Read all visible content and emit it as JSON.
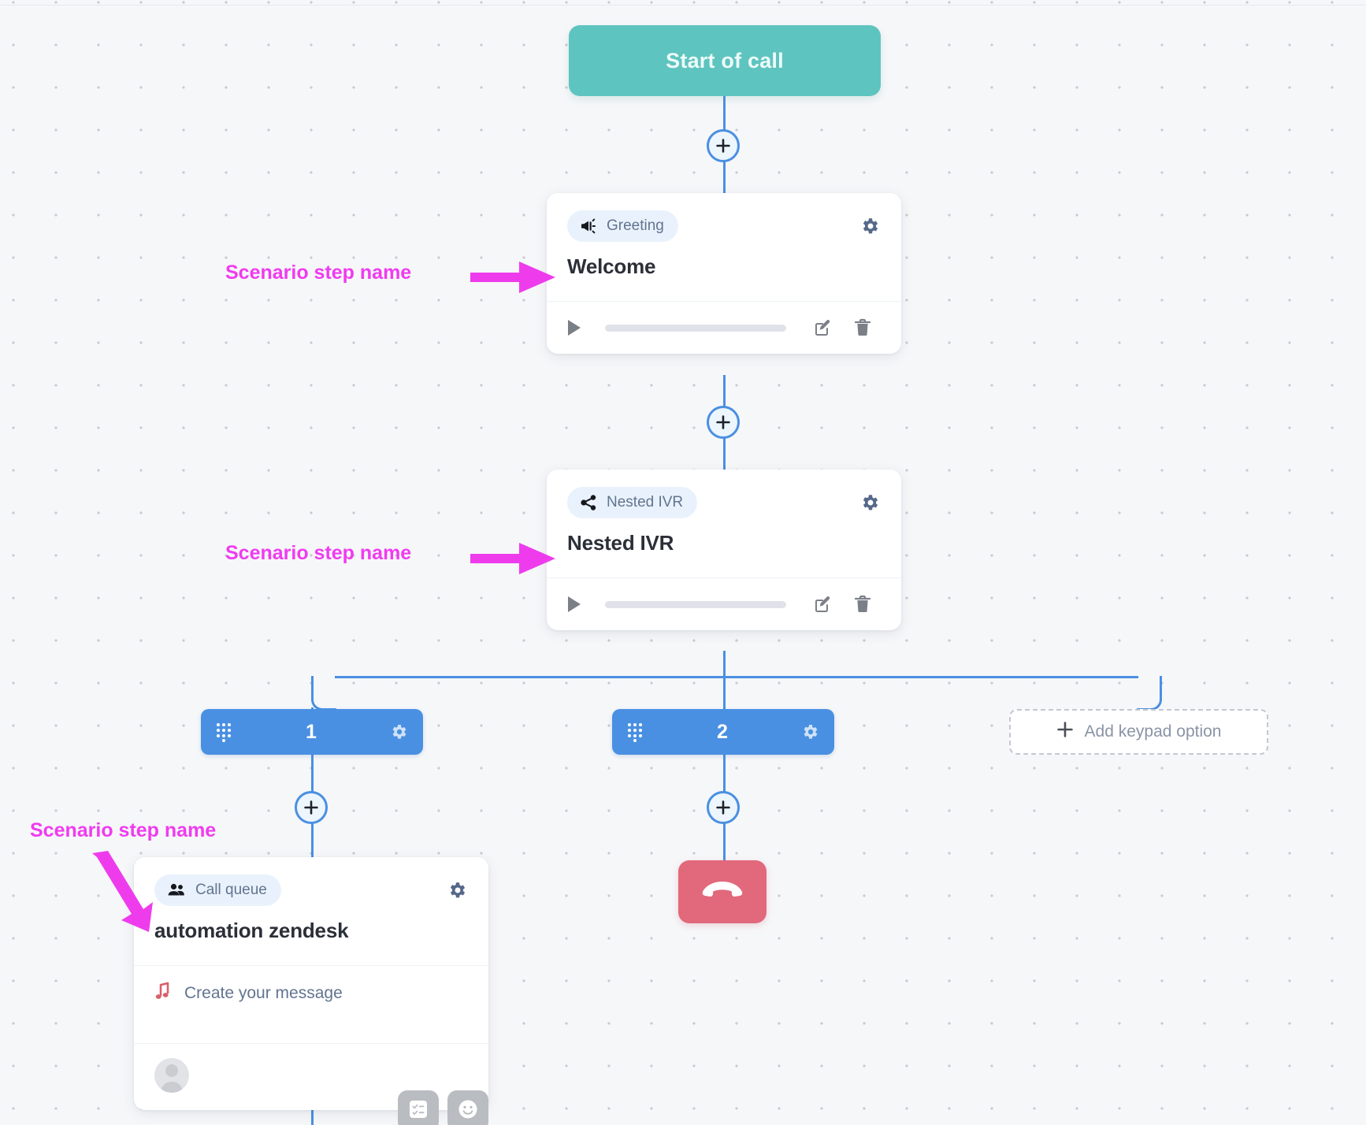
{
  "flow": {
    "start_node": {
      "label": "Start of call"
    },
    "steps": [
      {
        "badge_label": "Greeting",
        "badge_icon": "megaphone-icon",
        "title": "Welcome",
        "has_player": true
      },
      {
        "badge_label": "Nested IVR",
        "badge_icon": "share-icon",
        "title": "Nested IVR",
        "has_player": true
      },
      {
        "badge_label": "Call queue",
        "badge_icon": "people-icon",
        "title": "automation zendesk",
        "message_row_label": "Create your message",
        "message_row_icon": "music-note-icon"
      }
    ],
    "keypad_options": [
      {
        "digit": "1"
      },
      {
        "digit": "2"
      }
    ],
    "add_keypad_option": {
      "label": "Add keypad option",
      "icon": "plus-icon"
    },
    "hangup": {
      "icon": "hangup-phone-icon"
    },
    "add_step_buttons": [
      {
        "icon": "plus-icon"
      },
      {
        "icon": "plus-icon"
      },
      {
        "icon": "plus-icon"
      },
      {
        "icon": "plus-icon"
      }
    ],
    "player_controls": {
      "play_icon": "play-icon",
      "edit_icon": "edit-pencil-icon",
      "delete_icon": "trash-icon"
    },
    "settings_icon": "gear-icon"
  },
  "toolbar": {
    "chips": [
      {
        "icon": "checklist-icon"
      },
      {
        "icon": "smiley-icon"
      }
    ]
  },
  "annotations": [
    {
      "text": "Scenario step name",
      "arrow": "right-arrow"
    },
    {
      "text": "Scenario step name",
      "arrow": "right-arrow"
    },
    {
      "text": "Scenario step name",
      "arrow": "diagonal-down-right-arrow"
    }
  ],
  "colors": {
    "canvas_bg": "#f6f7f9",
    "dot_grid": "#c8cbd2",
    "start_node": "#5ec4bf",
    "connector": "#4a90e2",
    "keypad_button": "#4a90e2",
    "hangup": "#e2687b",
    "badge_bg": "#e9f2fc",
    "badge_text": "#62748f",
    "annotation": "#f03bf0",
    "card_bg": "#ffffff",
    "title_text": "#2b2f38"
  }
}
